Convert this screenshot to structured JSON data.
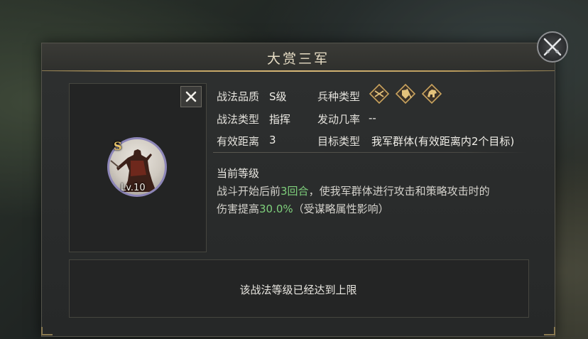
{
  "dialog": {
    "title": "大赏三军"
  },
  "skill": {
    "grade_badge": "S",
    "level_badge": "Lv.10",
    "quality_label": "战法品质",
    "quality_value": "S级",
    "unit_type_label": "兵种类型",
    "unit_type_icons": [
      "cavalry-shield-icon",
      "infantry-shield-icon",
      "archer-horse-icon"
    ],
    "type_label": "战法类型",
    "type_value": "指挥",
    "trigger_label": "发动几率",
    "trigger_value": "--",
    "range_label": "有效距离",
    "range_value": "3",
    "target_label": "目标类型",
    "target_value": "我军群体(有效距离内2个目标)"
  },
  "current_level": {
    "title": "当前等级",
    "line1_a": "战斗开始后前",
    "line1_hl": "3回合",
    "line1_b": "，使我军群体进行攻击和策略攻击时的",
    "line2_a": "伤害提高",
    "line2_hl": "30.0%",
    "line2_b": "（受谋略属性影响）"
  },
  "footer": {
    "max_level_text": "该战法等级已经达到上限"
  },
  "colors": {
    "accent_gold": "#b89a5c",
    "highlight_green": "#7fd07c",
    "portrait_ring": "#8d86b8"
  }
}
